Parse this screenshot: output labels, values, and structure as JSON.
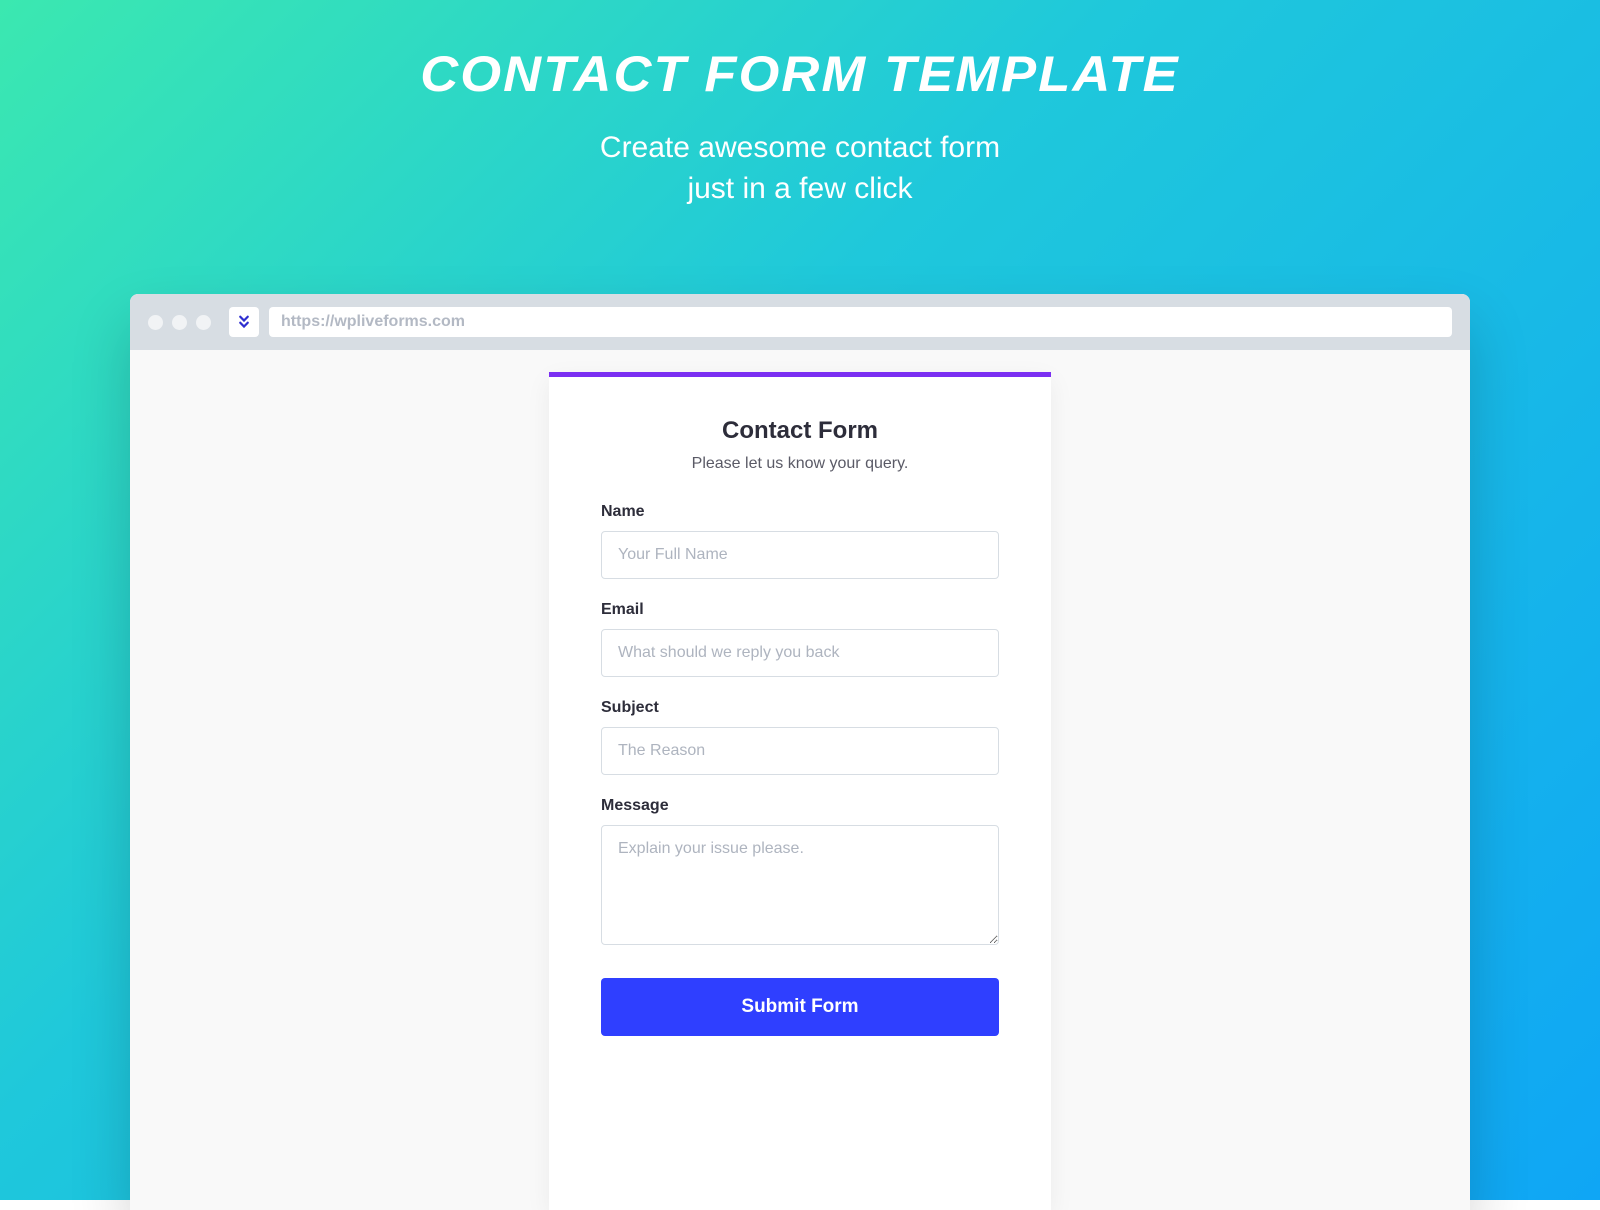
{
  "hero": {
    "title": "CONTACT FORM TEMPLATE",
    "subtitle_line1": "Create awesome contact form",
    "subtitle_line2": "just in a few click"
  },
  "browser": {
    "url": "https://wpliveforms.com",
    "favicon_glyph": "¥"
  },
  "form": {
    "title": "Contact Form",
    "subtitle": "Please let us know your query.",
    "fields": {
      "name": {
        "label": "Name",
        "placeholder": "Your Full Name"
      },
      "email": {
        "label": "Email",
        "placeholder": "What should we reply you back"
      },
      "subject": {
        "label": "Subject",
        "placeholder": "The Reason"
      },
      "message": {
        "label": "Message",
        "placeholder": "Explain your issue please."
      }
    },
    "submit_label": "Submit Form"
  },
  "colors": {
    "accent_bar": "#7b2ff2",
    "submit": "#2f3fff"
  }
}
